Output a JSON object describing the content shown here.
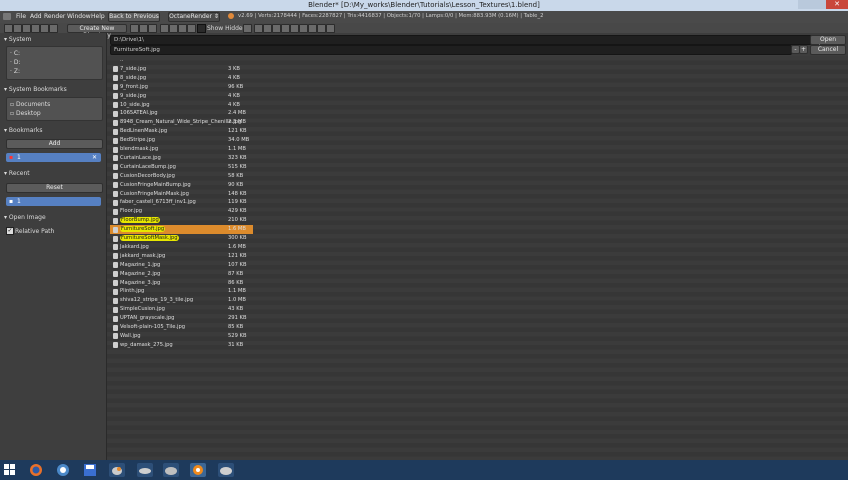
{
  "window": {
    "title": "Blender* [D:\\My_works\\Blender\\Tutorials\\Lesson_Textures\\1.blend]"
  },
  "menubar": {
    "items": [
      "File",
      "Add",
      "Render",
      "Window",
      "Help"
    ],
    "back_button": "Back to Previous",
    "renderer": "OctaneRender",
    "status": "v2.69 | Verts:2178444 | Faces:2287827 | Tris:4416837 | Objects:1/70 | Lamps:0/0 | Mem:883.93M (0.16M) | Table_2"
  },
  "toolbar": {
    "new_directory": "Create New Directory",
    "show_hidden": "Show Hidden"
  },
  "sidebar": {
    "system": {
      "header": "System",
      "drives": [
        "C:",
        "D:",
        "Z:"
      ]
    },
    "system_bookmarks": {
      "header": "System Bookmarks",
      "items": [
        "Documents",
        "Desktop"
      ]
    },
    "bookmarks": {
      "header": "Bookmarks",
      "add_label": "Add",
      "selected_item": "1"
    },
    "recent": {
      "header": "Recent",
      "reset_label": "Reset",
      "selected_item": "1"
    },
    "open_image": {
      "header": "Open Image",
      "relative_path": "Relative Path"
    }
  },
  "path": {
    "directory": "D:\\Drive\\1\\",
    "filename": "FurnitureSoft.jpg",
    "open_button": "Open Image",
    "cancel_button": "Cancel"
  },
  "files": [
    {
      "name": "..",
      "size": ""
    },
    {
      "name": "7_side.jpg",
      "size": "3 KB"
    },
    {
      "name": "8_side.jpg",
      "size": "4 KB"
    },
    {
      "name": "9_front.jpg",
      "size": "96 KB"
    },
    {
      "name": "9_side.jpg",
      "size": "4 KB"
    },
    {
      "name": "10_side.jpg",
      "size": "4 KB"
    },
    {
      "name": "1065ATEAI.jpg",
      "size": "2.4 MB"
    },
    {
      "name": "8948_Cream_Natural_Wide_Stripe_Chenille.jpg",
      "size": "2.3 MB"
    },
    {
      "name": "BedLinenMask.jpg",
      "size": "121 KB"
    },
    {
      "name": "BedStripe.jpg",
      "size": "34.0 MB"
    },
    {
      "name": "blendmask.jpg",
      "size": "1.1 MB"
    },
    {
      "name": "CurtainLace.jpg",
      "size": "323 KB"
    },
    {
      "name": "CurtainLaceBump.jpg",
      "size": "515 KB"
    },
    {
      "name": "CusionDecorBody.jpg",
      "size": "58 KB"
    },
    {
      "name": "CusionFringeMainBump.jpg",
      "size": "90 KB"
    },
    {
      "name": "CusionFringeMainMask.jpg",
      "size": "148 KB"
    },
    {
      "name": "faber_castell_6713ff_inv1.jpg",
      "size": "119 KB"
    },
    {
      "name": "Floor.jpg",
      "size": "429 KB"
    },
    {
      "name": "FloorBump.jpg",
      "size": "210 KB"
    },
    {
      "name": "FurnitureSoft.jpg",
      "size": "1.6 MB"
    },
    {
      "name": "FurnitureSoftMask.jpg",
      "size": "300 KB"
    },
    {
      "name": "Jakkard.jpg",
      "size": "1.6 MB"
    },
    {
      "name": "jakkard_mask.jpg",
      "size": "121 KB"
    },
    {
      "name": "Magazine_1.jpg",
      "size": "107 KB"
    },
    {
      "name": "Magazine_2.jpg",
      "size": "87 KB"
    },
    {
      "name": "Magazine_3.jpg",
      "size": "86 KB"
    },
    {
      "name": "Plinth.jpg",
      "size": "1.1 MB"
    },
    {
      "name": "shiva12_stripe_19_3_tile.jpg",
      "size": "1.0 MB"
    },
    {
      "name": "SimpleCusion.jpg",
      "size": "43 KB"
    },
    {
      "name": "UPTAN_grayscale.jpg",
      "size": "291 KB"
    },
    {
      "name": "Velsoft-plain-105_Tile.jpg",
      "size": "85 KB"
    },
    {
      "name": "Wall.jpg",
      "size": "529 KB"
    },
    {
      "name": "wp_damask_275.jpg",
      "size": "31 KB"
    }
  ],
  "colors": {
    "accent": "#dc8b2c",
    "selection_blue": "#5680c2",
    "highlight": "#e6e600"
  },
  "taskbar": {
    "icons": [
      "windows-start-icon",
      "firefox-icon",
      "browser-icon",
      "save-icon",
      "app-icon",
      "blender-icon",
      "app-icon",
      "blender-icon",
      "app-icon"
    ]
  }
}
